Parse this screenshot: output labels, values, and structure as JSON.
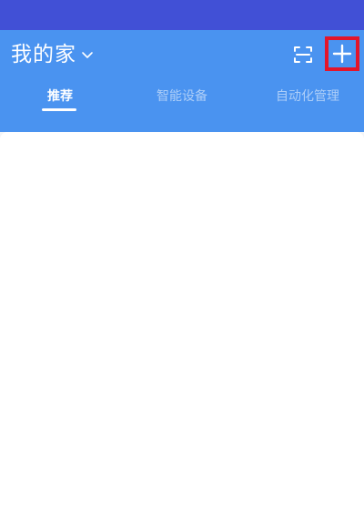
{
  "header": {
    "home_title": "我的家",
    "icons": {
      "dropdown": "chevron-down-icon",
      "scan": "scan-icon",
      "add": "plus-icon"
    },
    "highlight_color": "#e3152a"
  },
  "tabs": [
    {
      "label": "推荐",
      "active": true
    },
    {
      "label": "智能设备",
      "active": false
    },
    {
      "label": "自动化管理",
      "active": false
    }
  ],
  "colors": {
    "status_bar": "#4150d6",
    "header": "#4a93f0",
    "content": "#ffffff"
  }
}
